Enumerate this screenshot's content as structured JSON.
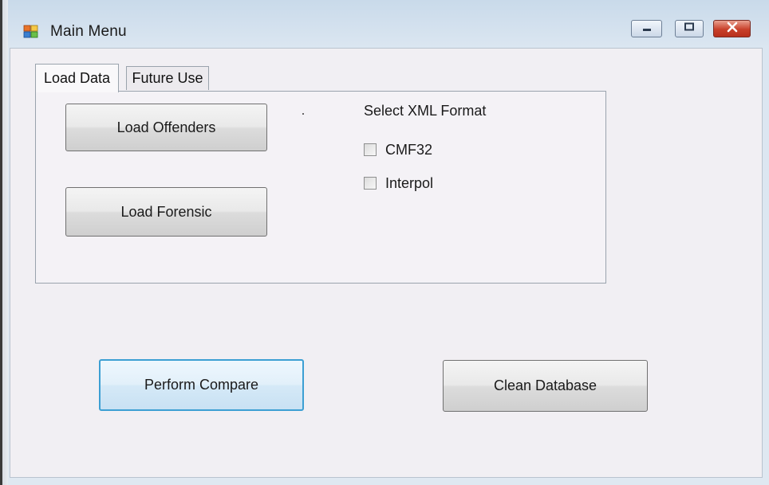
{
  "window": {
    "title": "Main Menu",
    "icon": "app-form-icon",
    "controls": {
      "minimize": "minimize-icon",
      "maximize": "maximize-icon",
      "close": "close-icon"
    }
  },
  "tabs": [
    {
      "label": "Load Data",
      "active": true
    },
    {
      "label": "Future Use",
      "active": false
    }
  ],
  "load_data": {
    "load_offenders_label": "Load Offenders",
    "load_forensic_label": "Load Forensic",
    "xml_format": {
      "heading": "Select XML Format",
      "options": [
        {
          "label": "CMF32",
          "checked": false
        },
        {
          "label": "Interpol",
          "checked": false
        }
      ]
    }
  },
  "actions": {
    "perform_compare_label": "Perform Compare",
    "clean_database_label": "Clean Database"
  },
  "colors": {
    "focus_border": "#3c9fd3",
    "close_button": "#c8402a",
    "client_background": "#f1eff3"
  }
}
